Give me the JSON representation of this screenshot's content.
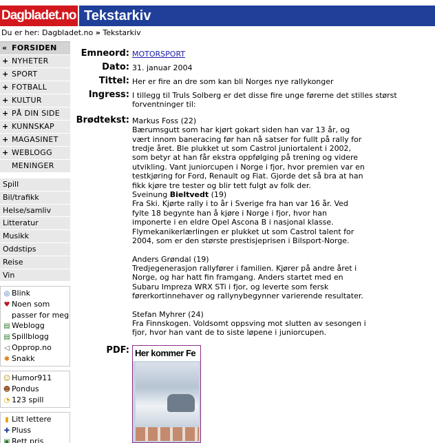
{
  "header": {
    "logo": "Dagbladet.no",
    "title": "Tekstarkiv"
  },
  "breadcrumb": {
    "prefix": "Du er her:",
    "home": "Dagbladet.no",
    "sep": "»",
    "current": "Tekstarkiv"
  },
  "nav": [
    {
      "label": "FORSIDEN",
      "marker": "«"
    },
    {
      "label": "NYHETER",
      "marker": "+"
    },
    {
      "label": "SPORT",
      "marker": "+"
    },
    {
      "label": "FOTBALL",
      "marker": "+"
    },
    {
      "label": "KULTUR",
      "marker": "+"
    },
    {
      "label": "PÅ DIN SIDE",
      "marker": "+"
    },
    {
      "label": "KUNNSKAP",
      "marker": "+"
    },
    {
      "label": "MAGASINET",
      "marker": "+"
    },
    {
      "label": "WEBLOGG",
      "marker": "+"
    },
    {
      "label": "MENINGER",
      "marker": ""
    }
  ],
  "subnav": [
    "Spill",
    "Bil/trafikk",
    "Helse/samliv",
    "Litteratur",
    "Musikk",
    "Oddstips",
    "Reise",
    "Vin"
  ],
  "box1": [
    {
      "icon": "blink-icon",
      "glyph": "◎",
      "label": "Blink"
    },
    {
      "icon": "heart-icon",
      "glyph": "♥",
      "label": "Noen som"
    },
    {
      "icon": "",
      "glyph": "",
      "label": "passer for meg"
    },
    {
      "icon": "weblogg-icon",
      "glyph": "▤",
      "label": "Weblogg"
    },
    {
      "icon": "spillblogg-icon",
      "glyph": "▤",
      "label": "Spillblogg"
    },
    {
      "icon": "megaphone-icon",
      "glyph": "◁",
      "label": "Opprop.no"
    },
    {
      "icon": "snakk-icon",
      "glyph": "✱",
      "label": "Snakk"
    }
  ],
  "box2": [
    {
      "icon": "humor-icon",
      "glyph": "☺",
      "label": "Humor911"
    },
    {
      "icon": "pondus-icon",
      "glyph": "☻",
      "label": "Pondus"
    },
    {
      "icon": "pacman-icon",
      "glyph": "◔",
      "label": "123 spill"
    }
  ],
  "box3": [
    {
      "icon": "pause-icon",
      "glyph": "▮",
      "label": "Litt lettere"
    },
    {
      "icon": "plus-icon",
      "glyph": "✚",
      "label": "Pluss"
    },
    {
      "icon": "price-icon",
      "glyph": "▣",
      "label": "Rett pris"
    }
  ],
  "article": {
    "labels": {
      "emneord": "Emneord:",
      "dato": "Dato:",
      "tittel": "Tittel:",
      "ingress": "Ingress:",
      "brodtekst": "Brødtekst:",
      "pdf": "PDF:"
    },
    "emneord": "MOTORSPORT",
    "dato": "31. januar 2004",
    "tittel": "Her er fire an dre som kan bli Norges nye rallykonger",
    "ingress": "I tillegg til Truls Solberg er det disse fire unge førerne det stilles størst forventninger til:",
    "p1_name": "Markus Foss (22)",
    "p1_text": "Bærumsgutt som har kjørt gokart siden han var 13 år, og vært innom baneracing før han nå satser for fullt på rally for tredje året. Ble plukket ut som Castrol juniortalent i 2002, som betyr at han får ekstra oppfølging på trening og videre utvikling. Vant juniorcupen i Norge i fjor, hvor premien var en testkjøring for Ford, Renault og Fiat. Gjorde det så bra at han fikk kjøre tre tester og blir tett fulgt av folk der.",
    "p2_first": "Sveinung ",
    "p2_last": "Bieltvedt",
    "p2_age": " (19)",
    "p2_text": "Fra Ski. Kjørte rally i to år i Sverige fra han var 16 år. Ved fylte 18 begynte han å kjøre i Norge i fjor, hvor han imponerte i en eldre Opel Ascona B i nasjonal klasse. Flymekanikerlærlingen er plukket ut som Castrol talent for 2004, som er den største prestisjeprisen i Bilsport-Norge.",
    "p3_name": "Anders Grøndal (19)",
    "p3_text": "Tredjegenerasjon rallyfører i familien. Kjører på andre året i Norge, og har hatt fin framgang. Anders startet med en Subaru Impreza WRX STi i fjor, og leverte som fersk førerkortinnehaver og rallynybegynner varierende resultater.",
    "p4_name": "Stefan Myhrer (24)",
    "p4_text": "Fra Finnskogen. Voldsomt oppsving mot slutten av sesongen i fjor, hvor han vant de to siste løpene i juniorcupen.",
    "pdf_headline": "Her kommer Fe"
  }
}
